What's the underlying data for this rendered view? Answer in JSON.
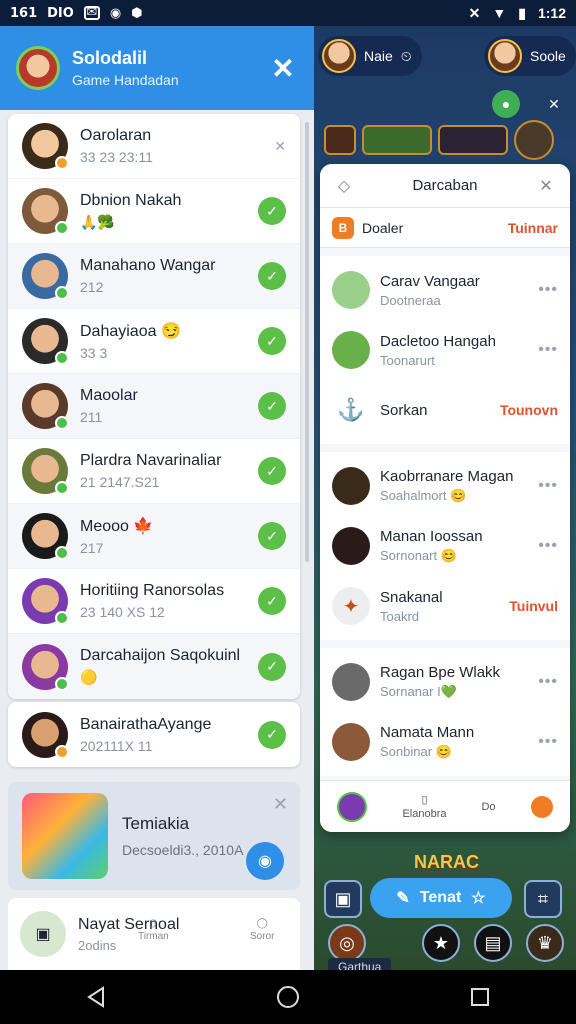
{
  "status_bar": {
    "left_items": [
      "161",
      "DIO"
    ],
    "time": "1:12"
  },
  "left_panel": {
    "header": {
      "title": "Solodalil",
      "subtitle": "Game Handadan"
    },
    "top_item": {
      "name": "Oarolaran",
      "sub": "33 23 23:11"
    },
    "friends": [
      {
        "name": "Dbnion Nakah",
        "sub": "",
        "emoji": "🙏🥦",
        "color": "#7c5a3a"
      },
      {
        "name": "Manahano Wangar",
        "sub": "212",
        "emoji": "",
        "color": "#3a6aa0"
      },
      {
        "name": "Dahayiaoa",
        "sub": "33 3",
        "emoji": "😏",
        "color": "#2a2a2a"
      },
      {
        "name": "Maoolar",
        "sub": "211",
        "emoji": "",
        "color": "#5a3a2a"
      },
      {
        "name": "Plardra Navarinaliar",
        "sub": "21 2147.S21",
        "emoji": "",
        "color": "#6a7a3a"
      },
      {
        "name": "Meooo",
        "sub": "217",
        "emoji": "🍁",
        "color": "#1a1a1a"
      },
      {
        "name": "Horitiing Ranorsolas",
        "sub": "23 140 XS 12",
        "emoji": "",
        "color": "#7a3ab0"
      },
      {
        "name": "Darcahaijon Saqokuinl",
        "sub": "",
        "emoji": "🟡",
        "color": "#8a3aa0"
      }
    ],
    "single_item": {
      "name": "BanairathaAyange",
      "sub": "202111X 11"
    },
    "game_card": {
      "title": "Temiakia",
      "sub": "Decsoeldi3., 2010A"
    },
    "bottom_item": {
      "name": "Nayat Sernoal",
      "sub": "2odins"
    },
    "bottom_tabs": [
      "Tirman",
      "Soror"
    ]
  },
  "game": {
    "player_left": {
      "name": "Naie"
    },
    "player_right": {
      "name": "Soole"
    },
    "banner": "NARAC",
    "toolbar_pill": "Tenat",
    "footer_label": "Garthua"
  },
  "right_panel": {
    "title": "Darcaban",
    "tab_row": {
      "badge": "B",
      "label": "Doaler",
      "action": "Tuinnar"
    },
    "group1": [
      {
        "name": "Carav Vangaar",
        "sub": "Dootneraa",
        "kind": "more",
        "color": "#9ad08a"
      },
      {
        "name": "Dacletoo Hangah",
        "sub": "Toonarurt",
        "kind": "more",
        "color": "#6ab04a"
      },
      {
        "name": "Sorkan",
        "sub": "",
        "kind": "action",
        "action": "Tounovn",
        "color": "#2f8ee6"
      }
    ],
    "group2": [
      {
        "name": "Kaobrranare Magan",
        "sub": "Soahalmort 😊",
        "kind": "more",
        "color": "#3a2a1a"
      },
      {
        "name": "Manan Ioossan",
        "sub": "Sornonart 😊",
        "kind": "more",
        "color": "#2a1a1a"
      },
      {
        "name": "Snakanal",
        "sub": "Toakrd",
        "kind": "action",
        "action": "Tuinvul",
        "color": "#e6e6e6"
      }
    ],
    "group3": [
      {
        "name": "Ragan Bpe Wlakk",
        "sub": "Sornanar I💚",
        "kind": "more",
        "color": "#6a6a6a"
      },
      {
        "name": "Namata Mann",
        "sub": "Sonbinar 😊",
        "kind": "more",
        "color": "#8a5a3a"
      }
    ],
    "footer_tabs": [
      "Elanobra",
      "Do"
    ]
  },
  "colors": {
    "header_blue": "#2f8ee6",
    "check_green": "#5cbf48",
    "action_red": "#e2522a"
  }
}
